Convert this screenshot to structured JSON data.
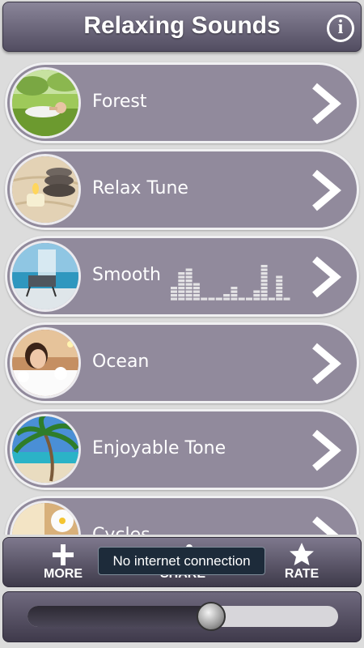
{
  "header": {
    "title": "Relaxing Sounds",
    "info_icon": "info-icon"
  },
  "items": [
    {
      "label": "Forest",
      "thumb": "forest-thumb"
    },
    {
      "label": "Relax Tune",
      "thumb": "candle-stones-thumb"
    },
    {
      "label": "Smooth",
      "thumb": "beach-chair-thumb",
      "playing": true
    },
    {
      "label": "Ocean",
      "thumb": "bath-thumb"
    },
    {
      "label": "Enjoyable Tone",
      "thumb": "palm-beach-thumb"
    },
    {
      "label": "Cycles",
      "thumb": "flower-thumb"
    }
  ],
  "bottom_bar": {
    "more_label": "MORE",
    "share_label": "SHARE",
    "rate_label": "RATE"
  },
  "toast": "No internet connection",
  "volume": {
    "level": 0.59
  },
  "colors": {
    "item_bg": "#918a9c",
    "header_bg": "#6b6579"
  }
}
